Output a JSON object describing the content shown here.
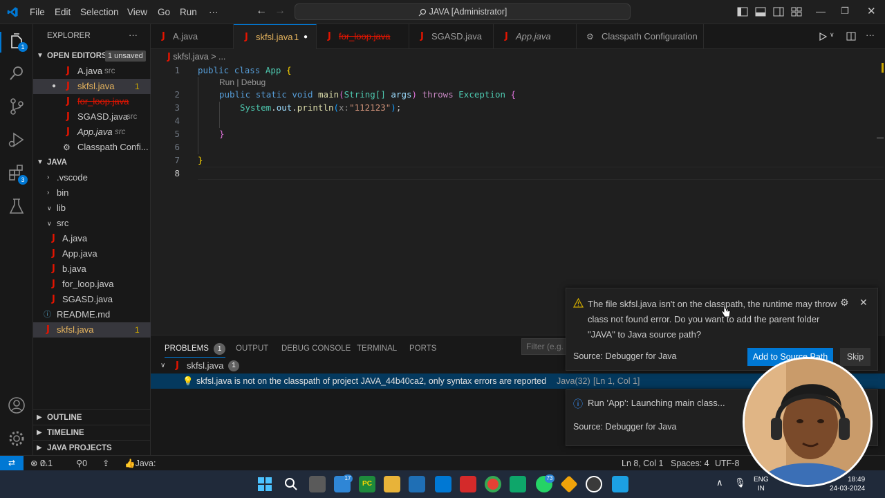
{
  "titlebar": {
    "menus": [
      "File",
      "Edit",
      "Selection",
      "View",
      "Go",
      "Run",
      "···"
    ],
    "search": "JAVA [Administrator]"
  },
  "activity": {
    "explorer_badge": "1",
    "extensions_badge": "3"
  },
  "sidebar": {
    "title": "EXPLORER",
    "more": "···",
    "open_editors": "OPEN EDITORS",
    "unsaved_badge": "1 unsaved",
    "open_files": [
      {
        "name": "A.java",
        "folder": "src",
        "count": ""
      },
      {
        "name": "skfsl.java",
        "folder": "",
        "count": "1"
      },
      {
        "name": "for_loop.java",
        "folder": "",
        "count": ""
      },
      {
        "name": "SGASD.java",
        "folder": "src",
        "count": ""
      },
      {
        "name": "App.java",
        "folder": "src",
        "count": ""
      },
      {
        "name": "Classpath Confi...",
        "folder": "",
        "count": ""
      }
    ],
    "project": "JAVA",
    "tree": [
      ".vscode",
      "bin",
      "lib",
      "src",
      "A.java",
      "App.java",
      "b.java",
      "for_loop.java",
      "SGASD.java",
      "README.md",
      "skfsl.java"
    ],
    "tree_count": "1",
    "outline": "OUTLINE",
    "timeline": "TIMELINE",
    "java_projects": "JAVA PROJECTS"
  },
  "tabs": [
    {
      "label": "A.java",
      "extra": ""
    },
    {
      "label": "skfsl.java",
      "extra": "1"
    },
    {
      "label": "for_loop.java",
      "extra": ""
    },
    {
      "label": "SGASD.java",
      "extra": ""
    },
    {
      "label": "App.java",
      "extra": ""
    },
    {
      "label": "Classpath Configuration",
      "extra": ""
    }
  ],
  "breadcrumb": {
    "file": "skfsl.java",
    "rest": "> ..."
  },
  "editor": {
    "line_numbers": [
      "1",
      "2",
      "3",
      "4",
      "5",
      "6",
      "7",
      "8"
    ],
    "codelens": "Run | Debug",
    "kw_public": "public",
    "kw_class": "class",
    "class_name": "App",
    "kw_static": "static",
    "kw_void": "void",
    "fn_main": "main",
    "param_type": "String[]",
    "param_name": "args",
    "kw_throws": "throws",
    "exc": "Exception",
    "sys": "System",
    "out": "out",
    "println": "println",
    "hint": "x:",
    "string_value": "\"112123\"",
    "open_brace": "{",
    "close_brace": "}",
    "paren_open": "(",
    "paren_close": ")",
    "semicolon": ";",
    "dot": "."
  },
  "panel": {
    "tabs": [
      "PROBLEMS",
      "OUTPUT",
      "DEBUG CONSOLE",
      "TERMINAL",
      "PORTS"
    ],
    "problems_count": "1",
    "filter_placeholder": "Filter (e.g. t",
    "file": "skfsl.java",
    "file_count": "1",
    "message": "skfsl.java is not on the classpath of project JAVA_44b40ca2, only syntax errors are reported",
    "source": "Java(32)",
    "location": "[Ln 1, Col 1]"
  },
  "notification1": {
    "line1": "The file skfsl.java isn't on the classpath, the runtime may throw",
    "line2": "class not found error. Do you want to add the parent folder",
    "line3": "\"JAVA\" to Java source path?",
    "source": "Source: Debugger for Java",
    "primary": "Add to Source Path",
    "secondary": "Skip"
  },
  "notification2": {
    "message": "Run 'App': Launching main class...",
    "source": "Source: Debugger for Java"
  },
  "status": {
    "errors": "0",
    "warnings": "1",
    "ports": "0",
    "java": "Java: Ready",
    "position": "Ln 8, Col 1",
    "spaces": "Spaces: 4",
    "encoding": "UTF-8"
  },
  "taskbar": {
    "lang": "ENG",
    "region": "IN",
    "time": "18:49",
    "date": "24-03-2024",
    "badge_a": "17",
    "badge_b": "73"
  },
  "colors": {
    "accent": "#0078d4",
    "java_red": "#e51400",
    "warning": "#cca700"
  }
}
